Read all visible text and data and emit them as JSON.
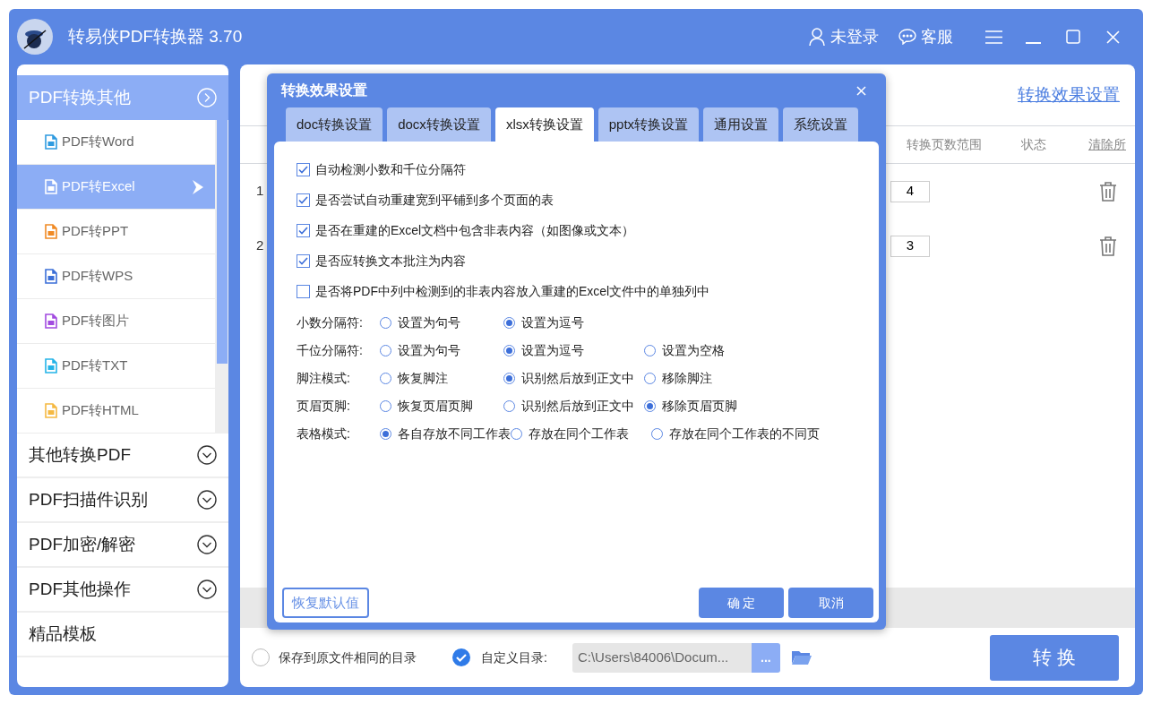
{
  "window": {
    "title": "转易侠PDF转换器 3.70",
    "user": "未登录",
    "support": "客服"
  },
  "sidebar": {
    "header": {
      "label": "PDF转换其他",
      "expanded": true
    },
    "items": [
      {
        "label": "PDF转Word",
        "color": "#2f9be0",
        "selected": false
      },
      {
        "label": "PDF转Excel",
        "color": "#ffffff",
        "selected": true
      },
      {
        "label": "PDF转PPT",
        "color": "#f08a24",
        "selected": false
      },
      {
        "label": "PDF转WPS",
        "color": "#3b6fd8",
        "selected": false
      },
      {
        "label": "PDF转图片",
        "color": "#a24be0",
        "selected": false
      },
      {
        "label": "PDF转TXT",
        "color": "#25b4e8",
        "selected": false
      },
      {
        "label": "PDF转HTML",
        "color": "#f5b942",
        "selected": false
      }
    ],
    "groups": [
      {
        "label": "其他转换PDF",
        "expandable": true
      },
      {
        "label": "PDF扫描件识别",
        "expandable": true
      },
      {
        "label": "PDF加密/解密",
        "expandable": true
      },
      {
        "label": "PDF其他操作",
        "expandable": true
      },
      {
        "label": "精品模板",
        "expandable": false
      }
    ]
  },
  "main": {
    "settings_link": "转换效果设置",
    "columns": [
      "转换页数范围",
      "状态",
      "清除所"
    ],
    "rows": [
      {
        "index": "1",
        "pages": "4"
      },
      {
        "index": "2",
        "pages": "3"
      }
    ],
    "save_options": [
      {
        "label": "保存到原文件相同的目录",
        "selected": false
      },
      {
        "label": "自定义目录:",
        "selected": true
      }
    ],
    "path": "C:\\Users\\84006\\Docum...",
    "browse": "...",
    "convert": "转 换"
  },
  "dialog": {
    "title": "转换效果设置",
    "tabs": [
      {
        "label": "doc转换设置",
        "selected": false
      },
      {
        "label": "docx转换设置",
        "selected": false
      },
      {
        "label": "xlsx转换设置",
        "selected": true
      },
      {
        "label": "pptx转换设置",
        "selected": false
      },
      {
        "label": "通用设置",
        "selected": false
      },
      {
        "label": "系统设置",
        "selected": false
      }
    ],
    "checkboxes": [
      {
        "label": "自动检测小数和千位分隔符",
        "checked": true
      },
      {
        "label": "是否尝试自动重建宽到平铺到多个页面的表",
        "checked": true
      },
      {
        "label": "是否在重建的Excel文档中包含非表内容（如图像或文本）",
        "checked": true
      },
      {
        "label": "是否应转换文本批注为内容",
        "checked": true
      },
      {
        "label": "是否将PDF中列中检测到的非表内容放入重建的Excel文件中的单独列中",
        "checked": false
      }
    ],
    "radio_groups": [
      {
        "label": "小数分隔符:",
        "options": [
          {
            "label": "设置为句号",
            "selected": false
          },
          {
            "label": "设置为逗号",
            "selected": true
          }
        ]
      },
      {
        "label": "千位分隔符:",
        "options": [
          {
            "label": "设置为句号",
            "selected": false
          },
          {
            "label": "设置为逗号",
            "selected": true
          },
          {
            "label": "设置为空格",
            "selected": false
          }
        ]
      },
      {
        "label": "脚注模式:",
        "options": [
          {
            "label": "恢复脚注",
            "selected": false
          },
          {
            "label": "识别然后放到正文中",
            "selected": true
          },
          {
            "label": "移除脚注",
            "selected": false
          }
        ]
      },
      {
        "label": "页眉页脚:",
        "options": [
          {
            "label": "恢复页眉页脚",
            "selected": false
          },
          {
            "label": "识别然后放到正文中",
            "selected": false
          },
          {
            "label": "移除页眉页脚",
            "selected": true
          }
        ]
      },
      {
        "label": "表格模式:",
        "options": [
          {
            "label": "各自存放不同工作表",
            "selected": true
          },
          {
            "label": "存放在同个工作表",
            "selected": false
          },
          {
            "label": "存放在同个工作表的不同页",
            "selected": false
          }
        ]
      }
    ],
    "reset": "恢复默认值",
    "ok": "确 定",
    "cancel": "取消"
  }
}
